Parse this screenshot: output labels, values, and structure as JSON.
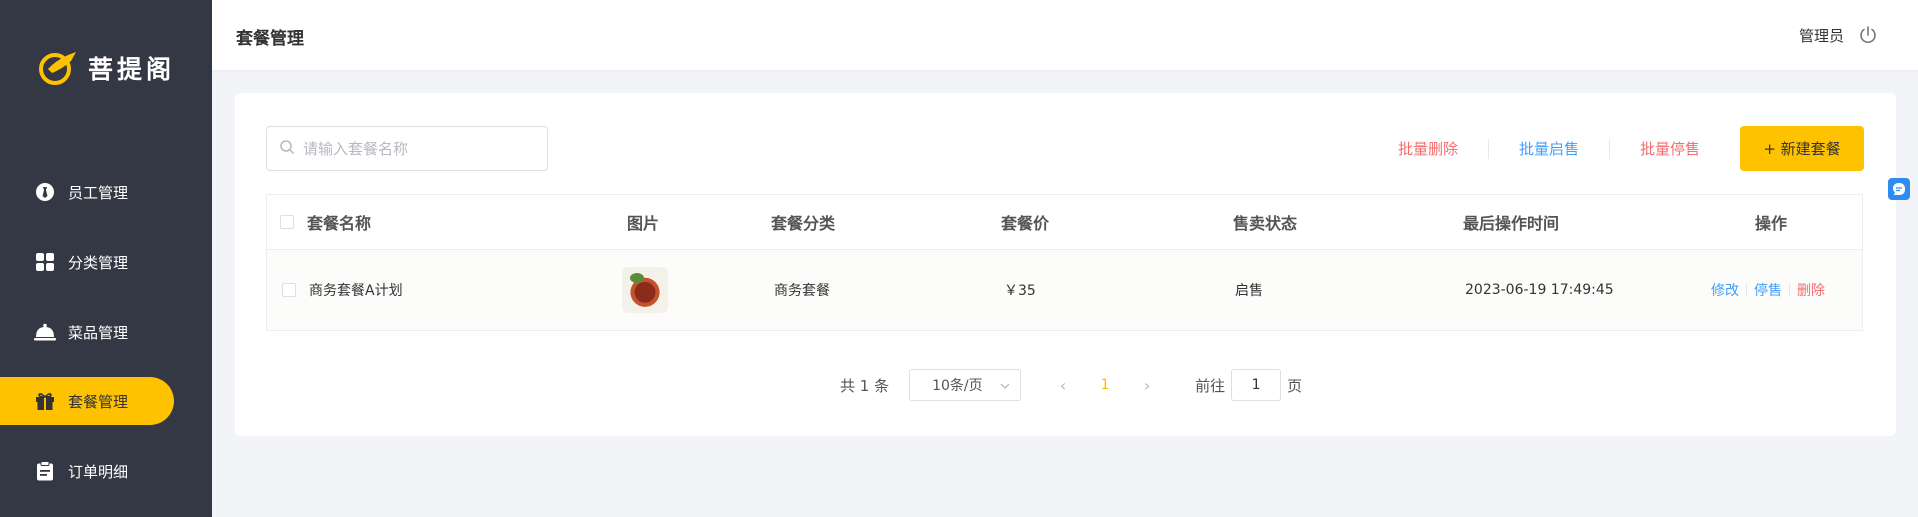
{
  "sidebar": {
    "logo_text": "菩提阁",
    "items": [
      {
        "label": "员工管理",
        "icon": "tie-icon"
      },
      {
        "label": "分类管理",
        "icon": "grid-icon"
      },
      {
        "label": "菜品管理",
        "icon": "cloche-icon"
      },
      {
        "label": "套餐管理",
        "icon": "gift-icon",
        "active": true
      },
      {
        "label": "订单明细",
        "icon": "clipboard-icon"
      }
    ]
  },
  "header": {
    "title": "套餐管理",
    "user": "管理员"
  },
  "toolbar": {
    "search_placeholder": "请输入套餐名称",
    "batch_delete": "批量删除",
    "batch_enable": "批量启售",
    "batch_disable": "批量停售",
    "new_button": "+ 新建套餐"
  },
  "table": {
    "columns": [
      "套餐名称",
      "图片",
      "套餐分类",
      "套餐价",
      "售卖状态",
      "最后操作时间",
      "操作"
    ],
    "rows": [
      {
        "name": "商务套餐A计划",
        "category": "商务套餐",
        "price": "￥35",
        "status": "启售",
        "updated": "2023-06-19 17:49:45",
        "ops": [
          "修改",
          "停售",
          "删除"
        ]
      }
    ]
  },
  "pagination": {
    "total_text": "共 1 条",
    "page_size": "10条/页",
    "current_page": "1",
    "goto_prefix": "前往",
    "goto_value": "1",
    "goto_suffix": "页"
  },
  "colors": {
    "sidebar_bg": "#343744",
    "accent": "#ffc200",
    "danger": "#f56c6c",
    "link": "#419eff"
  }
}
